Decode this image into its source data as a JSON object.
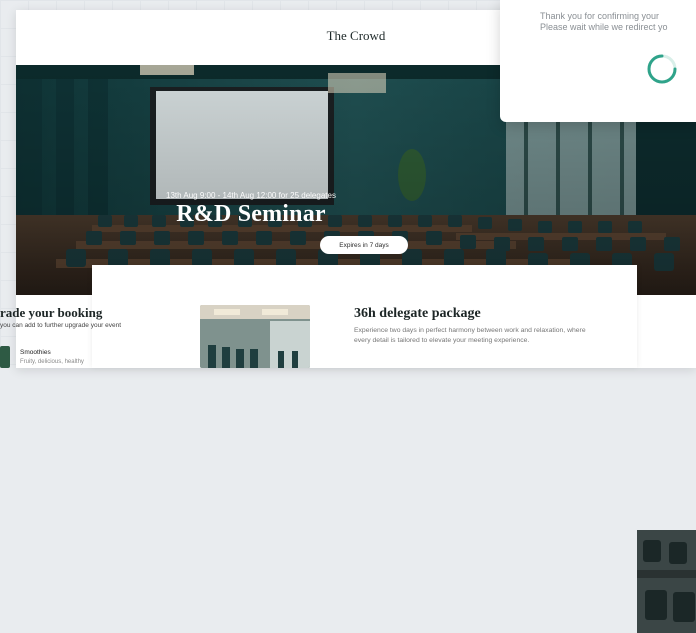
{
  "brand": "The Crowd",
  "hero": {
    "dates": "13th Aug 9:00 - 14th Aug 12:00 for 25 delegates",
    "title": "R&D Seminar",
    "expires": "Expires in 7 days"
  },
  "modal": {
    "line1": "Thank you for confirming your",
    "line2": "Please wait while we redirect yo"
  },
  "upgrade": {
    "title": "rade your booking",
    "subtitle": "you can add to further upgrade your event",
    "item_name": "Smoothies",
    "item_desc": "Fruity, delicious, healthy"
  },
  "package": {
    "title": "36h delegate package",
    "description": "Experience two days in perfect harmony between work and relaxation, where every detail is tailored to elevate your meeting experience."
  },
  "colors": {
    "accent": "#2fa38a",
    "room_teal": "#1e4d4f",
    "chair_teal": "#1b3b3e"
  }
}
